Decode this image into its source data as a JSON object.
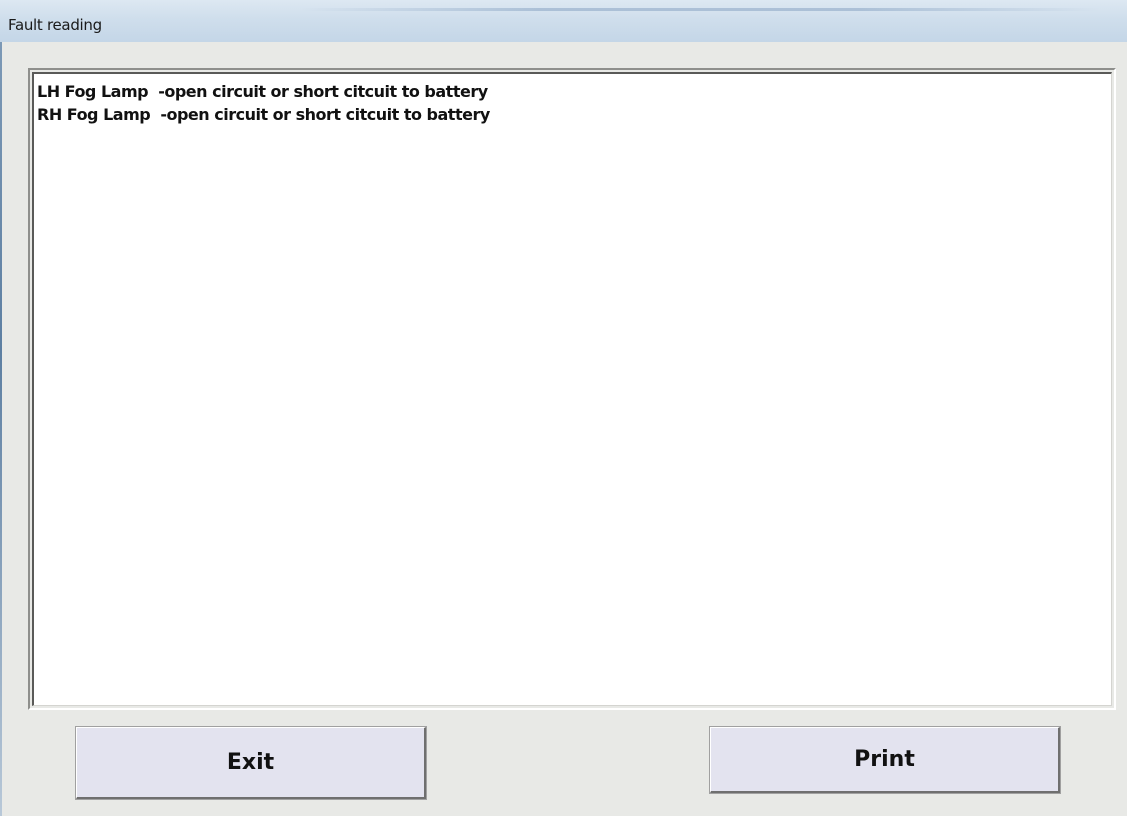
{
  "window": {
    "title": "Fault reading"
  },
  "faults": [
    "LH Fog Lamp  -open circuit or short citcuit to battery",
    "RH Fog Lamp  -open circuit or short citcuit to battery"
  ],
  "buttons": {
    "exit_label": "Exit",
    "print_label": "Print"
  },
  "colors": {
    "window_bg": "#e8e9e6",
    "button_bg": "#e3e3ef",
    "titlebar": "#cfdeec"
  }
}
